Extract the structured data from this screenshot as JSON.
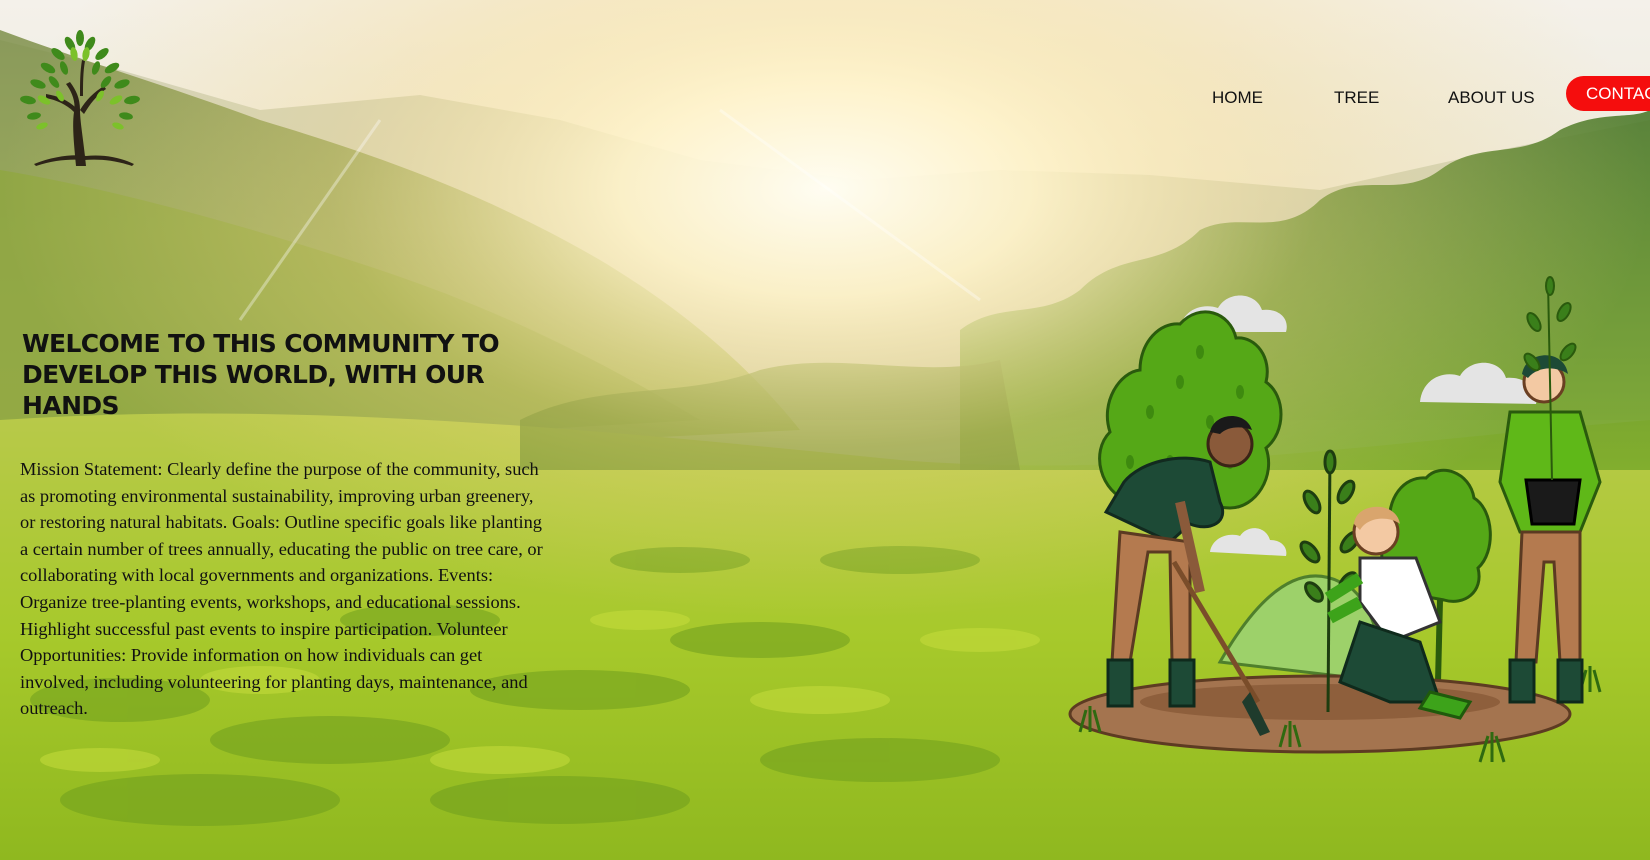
{
  "brand": {
    "logo_icon": "tree-logo-icon"
  },
  "nav": {
    "home": "HOME",
    "tree": "TREE",
    "about": "ABOUT US",
    "contact": "CONTACT"
  },
  "hero": {
    "title": "WELCOME TO THIS COMMUNITY TO DEVELOP THIS WORLD, WITH OUR HANDS",
    "body": "Mission Statement: Clearly define the purpose of the community, such as promoting environmental sustainability, improving urban greenery, or restoring natural habitats. Goals: Outline specific goals like planting a certain number of trees annually, educating the public on tree care, or collaborating with local governments and organizations. Events: Organize tree-planting events, workshops, and educational sessions. Highlight successful past events to inspire participation. Volunteer Opportunities: Provide information on how individuals can get involved, including volunteering for planting days, maintenance, and outreach."
  },
  "colors": {
    "contact_button": "#f50d0d",
    "text": "#111111",
    "accent_green": "#5fb818"
  },
  "illustration": {
    "icon": "people-planting-tree-illustration"
  }
}
